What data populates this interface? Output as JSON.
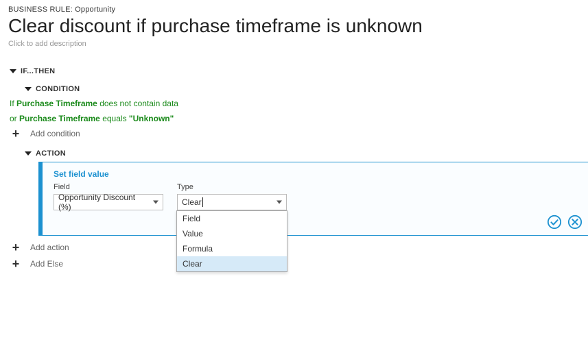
{
  "header": {
    "crumb_prefix": "BUSINESS RULE:",
    "crumb_entity": "Opportunity",
    "title": "Clear discount if purchase timeframe is unknown",
    "desc_placeholder": "Click to add description"
  },
  "ifthen": {
    "label": "IF...THEN",
    "condition": {
      "label": "CONDITION",
      "lines": [
        {
          "prefix": "If",
          "field": "Purchase Timeframe",
          "op": "does not contain data",
          "value": ""
        },
        {
          "prefix": "or",
          "field": "Purchase Timeframe",
          "op": "equals",
          "value": "\"Unknown\""
        }
      ],
      "add_label": "Add condition"
    },
    "action": {
      "label": "ACTION",
      "card_title": "Set field value",
      "field_label": "Field",
      "field_value": "Opportunity Discount (%)",
      "type_label": "Type",
      "type_value": "Clear",
      "type_options": [
        "Field",
        "Value",
        "Formula",
        "Clear"
      ],
      "type_selected": "Clear",
      "add_label": "Add action"
    }
  },
  "else": {
    "add_label": "Add Else"
  },
  "icons": {
    "confirm": "confirm-icon",
    "cancel": "cancel-icon",
    "plus": "plus-icon",
    "caret": "caret-icon",
    "dropdown": "dropdown-arrow-icon"
  }
}
